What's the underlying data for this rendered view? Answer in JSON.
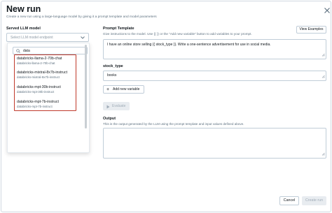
{
  "dialog": {
    "title": "New run",
    "subtitle": "Create a new run using a large-language model by giving it a prompt template and model parameters"
  },
  "model": {
    "label": "Served LLM model",
    "placeholder": "Select LLM model endpoint",
    "search_value": "data",
    "options": [
      {
        "name": "databricks-llama-2-70b-chat",
        "sub": "databricks-llama-2-70b-chat"
      },
      {
        "name": "databricks-mixtral-8x7b-instruct",
        "sub": "databricks-mixtral-8x7b-instruct"
      },
      {
        "name": "databricks-mpt-30b-instruct",
        "sub": "databricks-mpt-30b-instruct"
      },
      {
        "name": "databricks-mpt-7b-instruct",
        "sub": "databricks-mpt-7b-instruct"
      }
    ]
  },
  "prompt": {
    "label": "Prompt Template",
    "help": "Give instructions to the model. Use {{ }} or the \"Add new variable\" button to add variables to your prompt.",
    "view_examples": "View Examples",
    "value": "I have an online store selling {{ stock_type }}. Write a one-sentence advertisement for use in social media."
  },
  "variable": {
    "label": "stock_type",
    "value": "books",
    "add_button": "Add new variable"
  },
  "evaluate_button": "Evaluate",
  "output": {
    "label": "Output",
    "help": "This is the output generated by the LLM using the prompt template and input values defined above."
  },
  "footer": {
    "cancel": "Cancel",
    "create": "Create run"
  }
}
